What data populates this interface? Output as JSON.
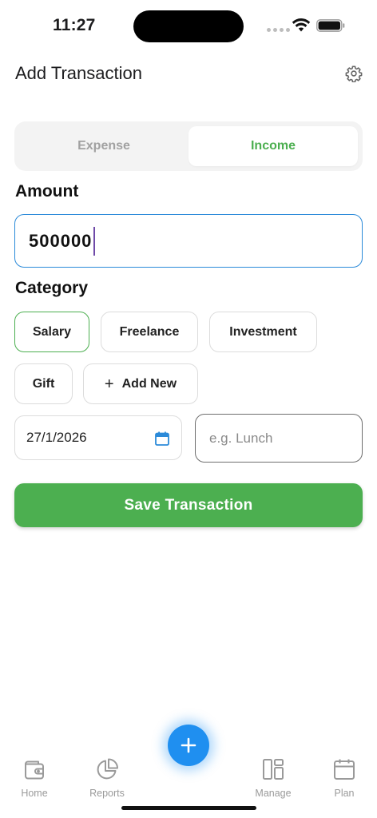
{
  "status_bar": {
    "time": "11:27"
  },
  "header": {
    "title": "Add Transaction"
  },
  "toggle": {
    "expense_label": "Expense",
    "income_label": "Income",
    "selected": "Income"
  },
  "amount": {
    "label": "Amount",
    "value": "500000"
  },
  "category": {
    "label": "Category",
    "chips": [
      "Salary",
      "Freelance",
      "Investment",
      "Gift"
    ],
    "selected": "Salary",
    "add_label": "Add New"
  },
  "date": {
    "value": "27/1/2026"
  },
  "note": {
    "placeholder": "e.g. Lunch",
    "value": ""
  },
  "save_button": {
    "label": "Save Transaction"
  },
  "nav": {
    "home": "Home",
    "reports": "Reports",
    "manage": "Manage",
    "plan": "Plan"
  },
  "colors": {
    "accent_green": "#4caf50",
    "accent_blue": "#1f8ff0",
    "input_focus": "#2b8ad9"
  }
}
